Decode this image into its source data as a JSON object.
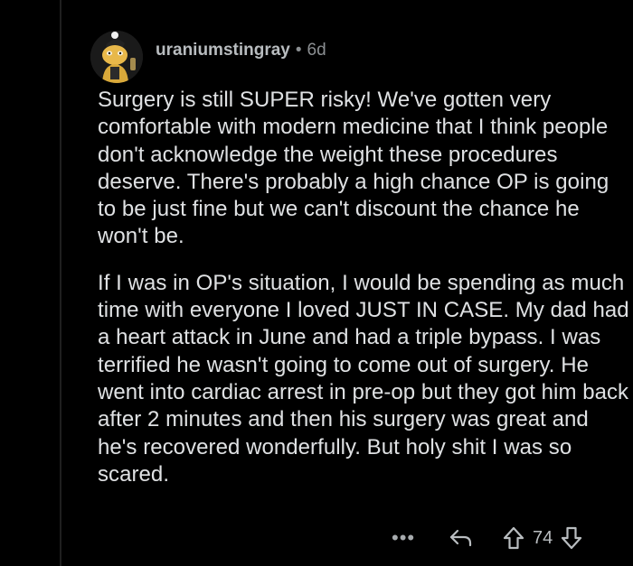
{
  "comment": {
    "author": "uraniumstingray",
    "separator": "•",
    "age": "6d",
    "paragraphs": [
      "Surgery is still SUPER risky! We've gotten very comfortable with modern medicine that I think people don't acknowledge the weight these procedures deserve. There's probably a high chance OP is going to be just fine but we can't discount the chance he won't be.",
      "If I was in OP's situation, I would be spending as much time with everyone I loved JUST IN CASE. My dad had a heart attack in June and had a triple bypass. I was terrified he wasn't going to come out of surgery. He went into cardiac arrest in pre-op but they got him back after 2 minutes and then his surgery was great and he's recovered wonderfully. But holy shit I was so scared."
    ],
    "actions": {
      "more_glyph": "•••",
      "vote_count": "74"
    }
  },
  "icons": {
    "avatar": "snoo-avatar-icon",
    "more": "more-options-icon",
    "reply": "reply-arrow-icon",
    "upvote": "upvote-arrow-icon",
    "downvote": "downvote-arrow-icon"
  },
  "colors": {
    "background": "#000000",
    "text": "#dfe1e3",
    "meta": "#8b8f92"
  }
}
